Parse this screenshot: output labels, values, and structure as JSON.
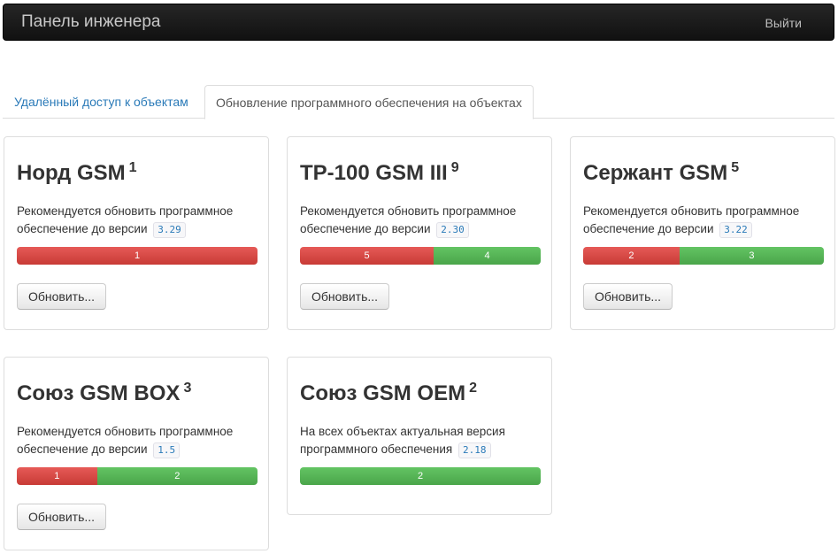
{
  "navbar": {
    "title": "Панель инженера",
    "logout": "Выйти"
  },
  "tabs": [
    {
      "label": "Удалённый доступ к объектам",
      "active": false
    },
    {
      "label": "Обновление программного обеспечения на объектах",
      "active": true
    }
  ],
  "colors": {
    "outdated": "#d9534f",
    "uptodate": "#5cb85c",
    "link": "#2a7ab8"
  },
  "cards": [
    {
      "name": "Норд GSM",
      "count": "1",
      "text": "Рекомендуется обновить программное обеспечение до версии",
      "version": "3.29",
      "outdated": 1,
      "uptodate": 0,
      "outdated_label": "1",
      "uptodate_label": "",
      "button": "Обновить..."
    },
    {
      "name": "ТР-100 GSM III",
      "count": "9",
      "text": "Рекомендуется обновить программное обеспечение до версии",
      "version": "2.30",
      "outdated": 5,
      "uptodate": 4,
      "outdated_label": "5",
      "uptodate_label": "4",
      "button": "Обновить..."
    },
    {
      "name": "Сержант GSM",
      "count": "5",
      "text": "Рекомендуется обновить программное обеспечение до версии",
      "version": "3.22",
      "outdated": 2,
      "uptodate": 3,
      "outdated_label": "2",
      "uptodate_label": "3",
      "button": "Обновить..."
    },
    {
      "name": "Союз GSM BOX",
      "count": "3",
      "text": "Рекомендуется обновить программное обеспечение до версии",
      "version": "1.5",
      "outdated": 1,
      "uptodate": 2,
      "outdated_label": "1",
      "uptodate_label": "2",
      "button": "Обновить..."
    },
    {
      "name": "Союз GSM OEM",
      "count": "2",
      "text": "На всех объектах актуальная версия программного обеспечения",
      "version": "2.18",
      "outdated": 0,
      "uptodate": 2,
      "outdated_label": "",
      "uptodate_label": "2",
      "button": ""
    }
  ]
}
